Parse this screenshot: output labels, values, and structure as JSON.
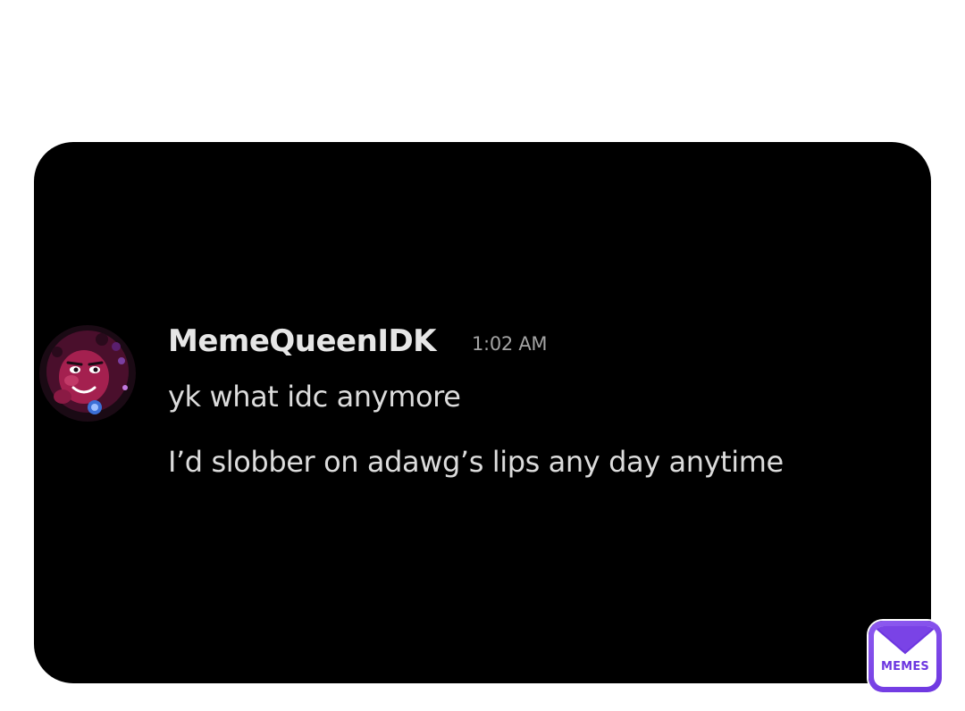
{
  "message": {
    "username": "MemeQueenIDK",
    "timestamp": "1:02 AM",
    "lines": [
      "yk what idc anymore",
      "I’d slobber on adawg’s lips any day anytime"
    ],
    "avatar_icon": "cartoon-character-avatar"
  },
  "watermark": {
    "label": "MEMES",
    "icon": "envelope-icon",
    "color": "#7a43e6"
  },
  "colors": {
    "card_background": "#000000",
    "page_background": "#ffffff",
    "username": "#e6e6e6",
    "timestamp": "#a3a3a3",
    "message_text": "#dcdcdc"
  }
}
